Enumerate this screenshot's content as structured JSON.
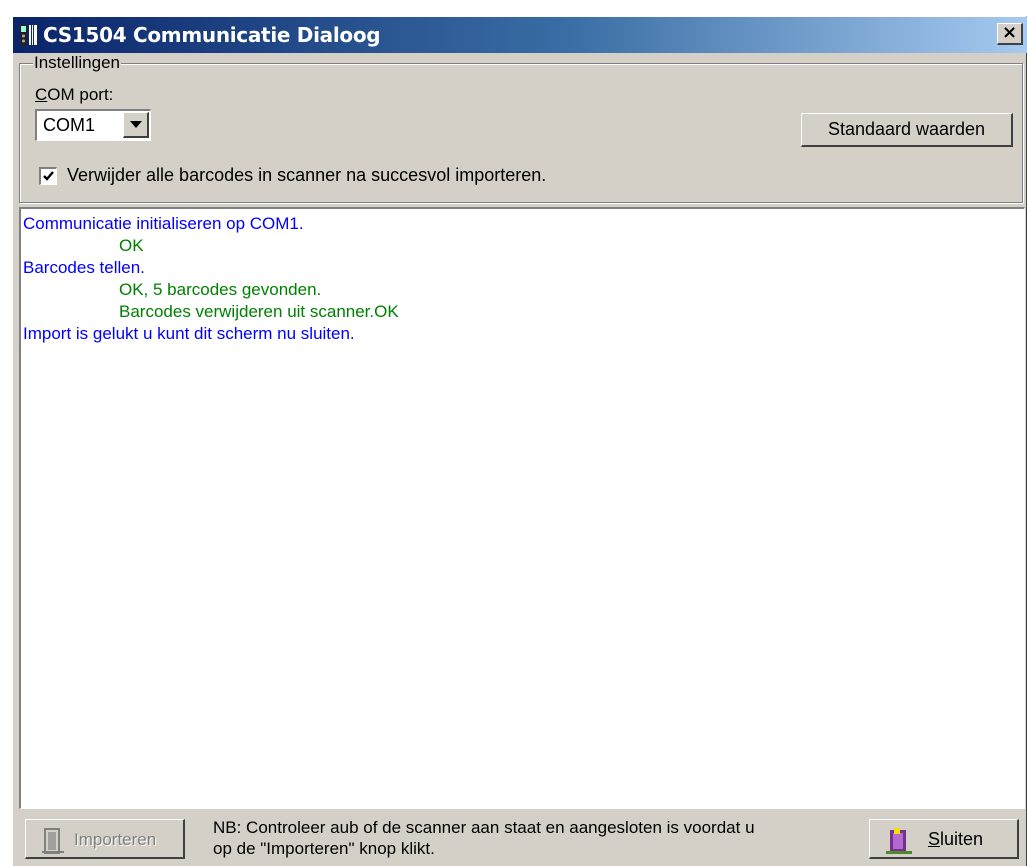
{
  "window": {
    "title": "CS1504 Communicatie Dialoog",
    "close_glyph": "×"
  },
  "settings": {
    "group_label": "Instellingen",
    "com_label_underlined": "C",
    "com_label_rest": "OM port:",
    "com_value": "COM1",
    "defaults_button": "Standaard waarden",
    "delete_checkbox_checked": true,
    "delete_checkbox_label": "Verwijder alle barcodes in scanner na succesvol importeren."
  },
  "log": {
    "colors": {
      "info": "#0000ff",
      "ok": "#008000"
    },
    "lines": [
      {
        "text": "Communicatie initialiseren op COM1.",
        "kind": "info"
      },
      {
        "text": "OK",
        "kind": "ok"
      },
      {
        "text": "Barcodes tellen.",
        "kind": "info"
      },
      {
        "text": "OK, 5 barcodes gevonden.",
        "kind": "ok"
      },
      {
        "text": "Barcodes verwijderen uit scanner.OK",
        "kind": "ok"
      },
      {
        "text": "Import is gelukt u kunt dit scherm nu sluiten.",
        "kind": "info"
      }
    ]
  },
  "footer": {
    "import_button": "Importeren",
    "import_enabled": false,
    "note_line1": "NB: Controleer aub of de scanner aan staat en aangesloten is voordat u",
    "note_line2": "op de \"Importeren\" knop klikt.",
    "close_underlined": "S",
    "close_rest": "luiten",
    "import_icon": "door-icon",
    "close_icon": "exit-door-icon"
  }
}
